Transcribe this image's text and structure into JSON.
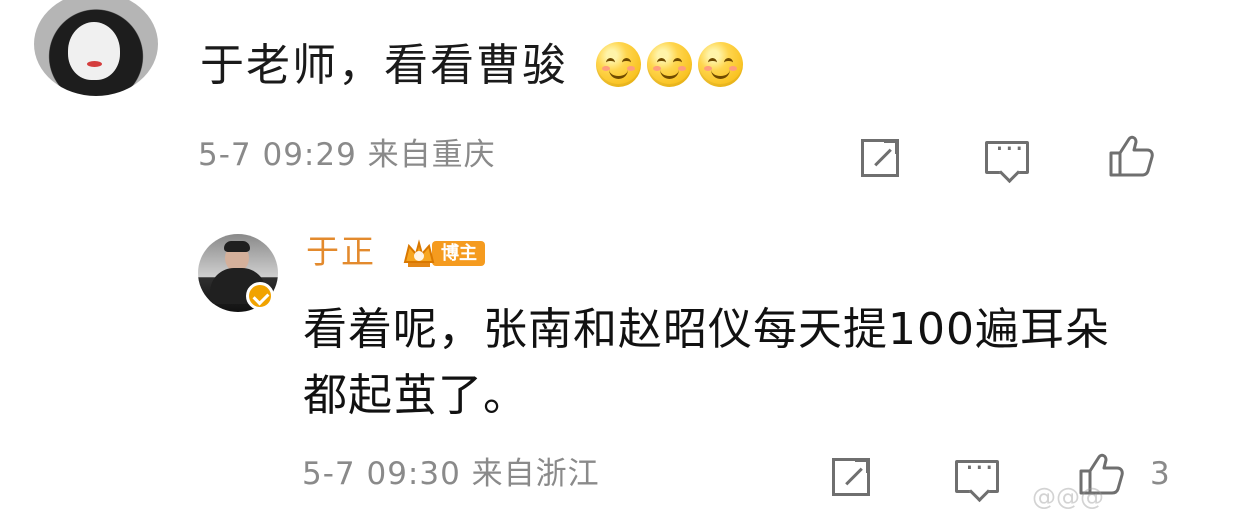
{
  "comment": {
    "text": "于老师，看看曹骏",
    "emoji_count": 3,
    "meta": "5-7 09:29 来自重庆"
  },
  "reply": {
    "author": "于正",
    "badge_label": "博主",
    "text": "看着呢，张南和赵昭仪每天提100遍耳朵都起茧了。",
    "meta": "5-7 09:30 来自浙江",
    "like_count": "3"
  },
  "icons": {
    "repost": "repost-icon",
    "comment": "comment-icon",
    "like": "like-icon",
    "verified": "verified-icon",
    "crown": "crown-icon"
  },
  "colors": {
    "accent_name": "#e38a2d",
    "meta_gray": "#8a8a8a",
    "badge_orange": "#f59b1f"
  }
}
